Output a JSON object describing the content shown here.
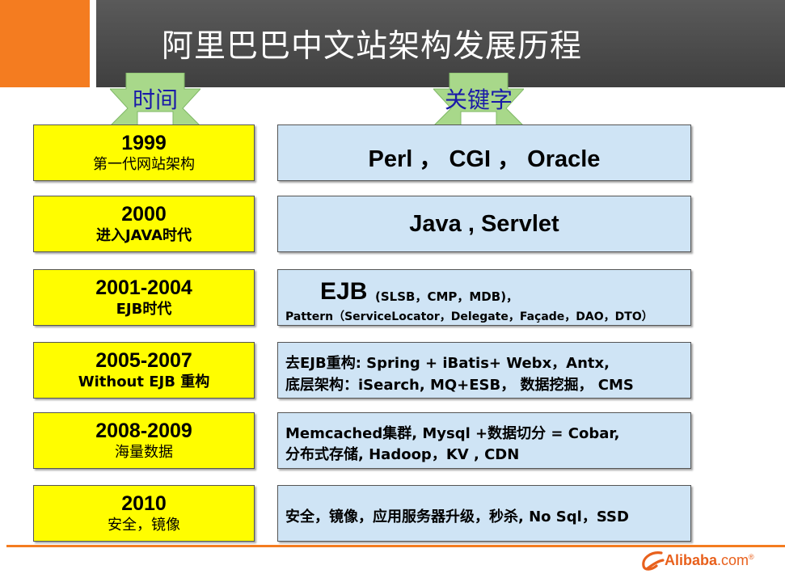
{
  "title": "阿里巴巴中文站架构发展历程",
  "headers": {
    "time": "时间",
    "keywords": "关键字"
  },
  "rows": [
    {
      "year": "1999",
      "sub": "第一代网站架构",
      "keywords": "Perl ， CGI ， Oracle"
    },
    {
      "year": "2000",
      "sub": "进入JAVA时代",
      "keywords": "Java , Servlet"
    },
    {
      "year": "2001-2004",
      "sub": "EJB时代",
      "ejb": "EJB",
      "ejb_paren": "(SLSB，CMP，MDB)，",
      "ejb_pattern": "Pattern（ServiceLocator，Delegate，Façade，DAO，DTO）"
    },
    {
      "year": "2005-2007",
      "sub": "Without EJB 重构",
      "line1": "去EJB重构: Spring + iBatis+ Webx，Antx,",
      "line2": "底层架构：iSearch,  MQ+ESB， 数据挖掘， CMS"
    },
    {
      "year": "2008-2009",
      "sub": "海量数据",
      "line1": "Memcached集群, Mysql +数据切分 = Cobar,",
      "line2": "分布式存储, Hadoop，KV , CDN"
    },
    {
      "year": "2010",
      "sub": "安全，镜像",
      "line1": "安全，镜像，应用服务器升级，秒杀, No Sql，SSD"
    }
  ],
  "logo": {
    "brand": "Alibaba",
    "suffix": ".com",
    "tm": "®"
  },
  "colors": {
    "accent": "#f47c20",
    "title_bar": "#4a4a4a",
    "yellow": "#fffd00",
    "blue": "#cfe4f5",
    "badge": "#a8d88a"
  }
}
